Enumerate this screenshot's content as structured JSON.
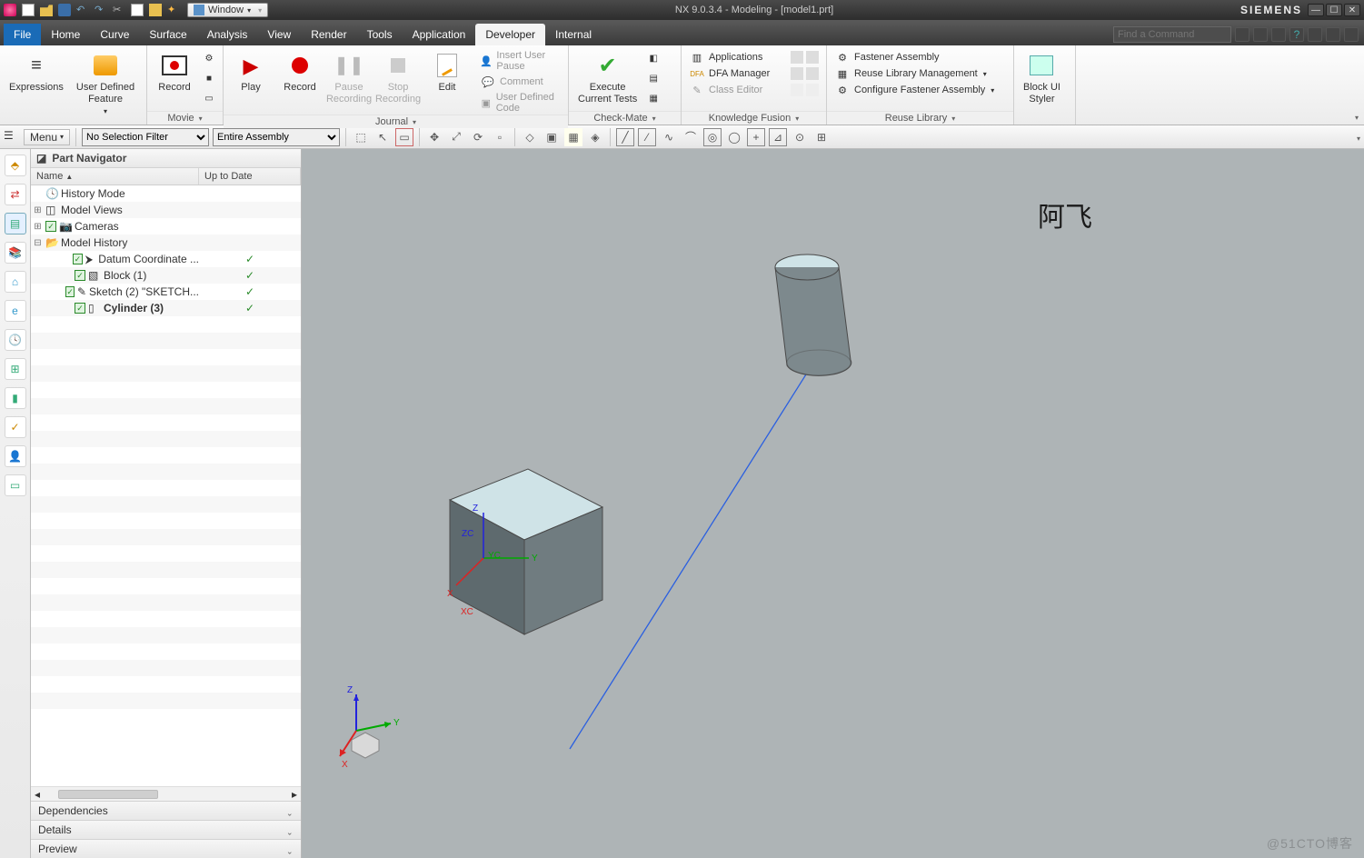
{
  "app": {
    "version": "NX 9.0.3.4",
    "mode": "Modeling",
    "document": "[model1.prt]",
    "brand": "SIEMENS"
  },
  "window_menu": "Window",
  "menu_label": "Menu",
  "tabs": [
    "File",
    "Home",
    "Curve",
    "Surface",
    "Analysis",
    "View",
    "Render",
    "Tools",
    "Application",
    "Developer",
    "Internal"
  ],
  "active_tab": "Developer",
  "search_placeholder": "Find a Command",
  "ribbon": {
    "group_expressions": {
      "expressions": "Expressions",
      "user_defined_feature": "User Defined\nFeature"
    },
    "group_movie": {
      "label": "Movie",
      "record": "Record"
    },
    "group_journal": {
      "label": "Journal",
      "play": "Play",
      "record": "Record",
      "pause": "Pause\nRecording",
      "stop": "Stop\nRecording",
      "edit": "Edit",
      "items": [
        "Insert User Pause",
        "Comment",
        "User Defined Code"
      ]
    },
    "group_checkmate": {
      "label": "Check-Mate",
      "execute": "Execute\nCurrent Tests"
    },
    "group_knowledge": {
      "label": "Knowledge Fusion",
      "items": [
        "Applications",
        "DFA Manager",
        "Class Editor"
      ]
    },
    "group_reuse": {
      "label": "Reuse Library",
      "items": [
        "Fastener Assembly",
        "Reuse Library Management",
        "Configure Fastener Assembly"
      ]
    },
    "group_blockui": {
      "styler": "Block UI\nStyler"
    }
  },
  "selection": {
    "filter": "No Selection Filter",
    "scope": "Entire Assembly"
  },
  "navigator": {
    "title": "Part Navigator",
    "columns": {
      "name": "Name",
      "uptodate": "Up to Date"
    },
    "items": [
      {
        "label": "History Mode",
        "indent": 1,
        "exp": "",
        "chk": false,
        "ico": "clock",
        "ok": false
      },
      {
        "label": "Model Views",
        "indent": 1,
        "exp": "+",
        "chk": false,
        "ico": "views",
        "ok": false
      },
      {
        "label": "Cameras",
        "indent": 1,
        "exp": "+",
        "chk": true,
        "ico": "camera",
        "ok": false
      },
      {
        "label": "Model History",
        "indent": 1,
        "exp": "-",
        "chk": false,
        "ico": "folder",
        "ok": false
      },
      {
        "label": "Datum Coordinate ...",
        "indent": 3,
        "exp": "",
        "chk": true,
        "ico": "csys",
        "ok": true
      },
      {
        "label": "Block (1)",
        "indent": 3,
        "exp": "",
        "chk": true,
        "ico": "block",
        "ok": true
      },
      {
        "label": "Sketch (2) \"SKETCH...",
        "indent": 3,
        "exp": "",
        "chk": true,
        "ico": "sketch",
        "ok": true
      },
      {
        "label": "Cylinder (3)",
        "indent": 3,
        "exp": "",
        "chk": true,
        "ico": "cyl",
        "ok": true,
        "bold": true
      }
    ],
    "sections": [
      "Dependencies",
      "Details",
      "Preview"
    ]
  },
  "viewport": {
    "annotation": "阿飞",
    "watermark": "@51CTO博客",
    "axis_labels": {
      "x": "X",
      "y": "Y",
      "z": "Z",
      "xc": "XC",
      "yc": "YC",
      "zc": "ZC"
    }
  }
}
